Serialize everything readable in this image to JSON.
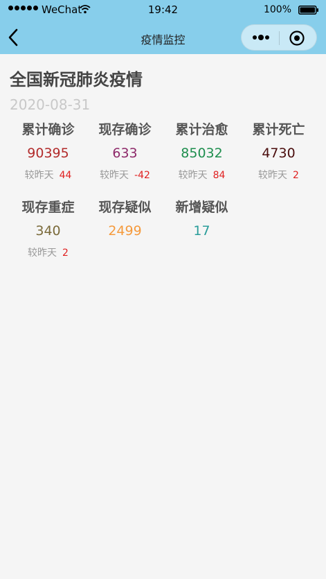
{
  "status_bar": {
    "carrier": "WeChat",
    "time": "19:42",
    "battery": "100%"
  },
  "nav": {
    "title": "疫情监控",
    "icons": [
      "back-icon",
      "more-icon",
      "close-icon"
    ]
  },
  "page": {
    "title": "全国新冠肺炎疫情",
    "date": "2020-08-31"
  },
  "compare_label": "较昨天",
  "stats": [
    {
      "label": "累计确诊",
      "value": "90395",
      "change": "44",
      "color": "#b22b2b"
    },
    {
      "label": "现存确诊",
      "value": "633",
      "change": "-42",
      "color": "#8e2a6a"
    },
    {
      "label": "累计治愈",
      "value": "85032",
      "change": "84",
      "color": "#1e8e4e"
    },
    {
      "label": "累计死亡",
      "value": "4730",
      "change": "2",
      "color": "#4a0d0d"
    },
    {
      "label": "现存重症",
      "value": "340",
      "change": "2",
      "color": "#7a6a3a"
    },
    {
      "label": "现存疑似",
      "value": "2499",
      "change": "",
      "color": "#f59a3c"
    },
    {
      "label": "新增疑似",
      "value": "17",
      "change": "",
      "color": "#2a9d9a"
    }
  ],
  "colors": {
    "header": "#87ceeb",
    "background": "#f5f5f5",
    "increase": "#e02020"
  }
}
